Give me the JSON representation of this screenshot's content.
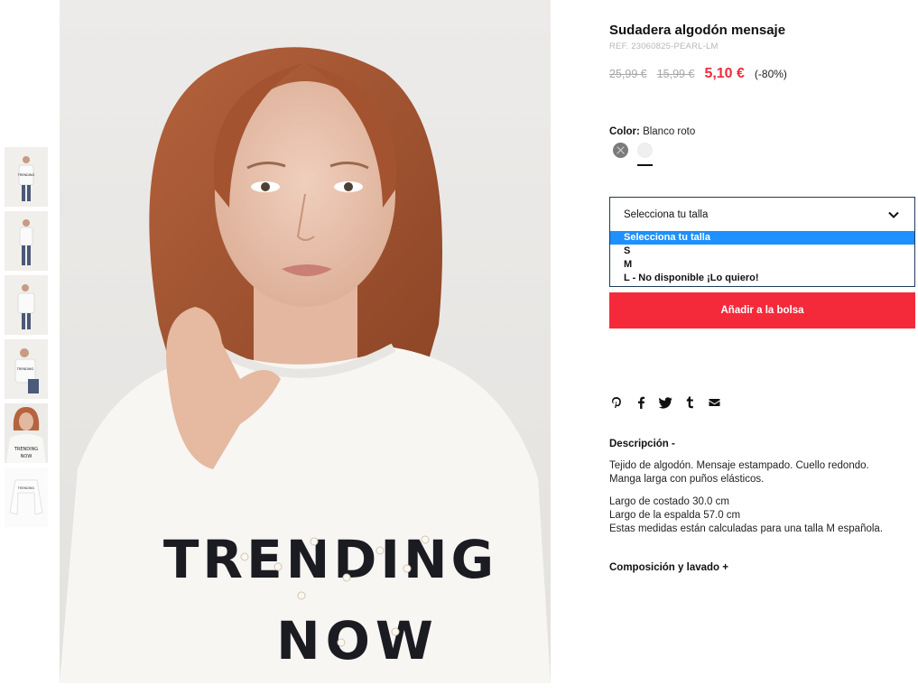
{
  "product": {
    "title": "Sudadera algodón mensaje",
    "ref": "REF. 23060825-PEARL-LM",
    "price_original": "25,99 €",
    "price_previous": "15,99 €",
    "price_current": "5,10 €",
    "discount": "(-80%)",
    "brand_color": "#f42a3b",
    "price_color": "#ef2c3b"
  },
  "image_text": {
    "line1": "TRENDING",
    "line2": "NOW"
  },
  "color": {
    "label": "Color:",
    "value": "Blanco roto",
    "swatches": [
      {
        "name": "gray",
        "hex": "#7b7b7b",
        "available": false
      },
      {
        "name": "white",
        "hex": "#efefef",
        "available": true,
        "selected": true
      }
    ]
  },
  "size_select": {
    "selected": "Selecciona tu talla",
    "options": [
      "Selecciona tu talla",
      "S",
      "M",
      "L - No disponible ¡Lo quiero!"
    ],
    "highlight_color": "#1e90ff"
  },
  "add_to_bag": "Añadir a la bolsa",
  "share_icons": [
    "pinterest-icon",
    "facebook-icon",
    "twitter-icon",
    "tumblr-icon",
    "email-icon"
  ],
  "description": {
    "title": "Descripción  -",
    "lines": [
      "Tejido de algodón. Mensaje estampado. Cuello redondo.",
      "Manga larga con puños elásticos.",
      "Largo de costado 30.0 cm",
      "Largo de la espalda 57.0 cm",
      "Estas medidas están calculadas para una talla M española."
    ]
  },
  "composition": {
    "title": "Composición y lavado  +"
  }
}
